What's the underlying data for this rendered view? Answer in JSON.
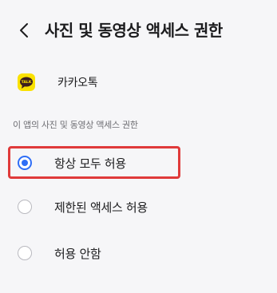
{
  "header": {
    "back_icon": "chevron-left-icon",
    "title": "사진 및 동영상 액세스 권한"
  },
  "app": {
    "icon": "kakaotalk-icon",
    "icon_text": "TALK",
    "icon_color": "#fae100",
    "name": "카카오톡"
  },
  "section": {
    "label": "이 앱의 사진 및 동영상 액세스 권한"
  },
  "options": [
    {
      "label": "항상 모두 허용",
      "selected": true
    },
    {
      "label": "제한된 액세스 허용",
      "selected": false
    },
    {
      "label": "허용 안함",
      "selected": false
    }
  ],
  "colors": {
    "accent": "#2f6ef6",
    "highlight": "#e03a3a",
    "background": "#f6f6f8"
  }
}
